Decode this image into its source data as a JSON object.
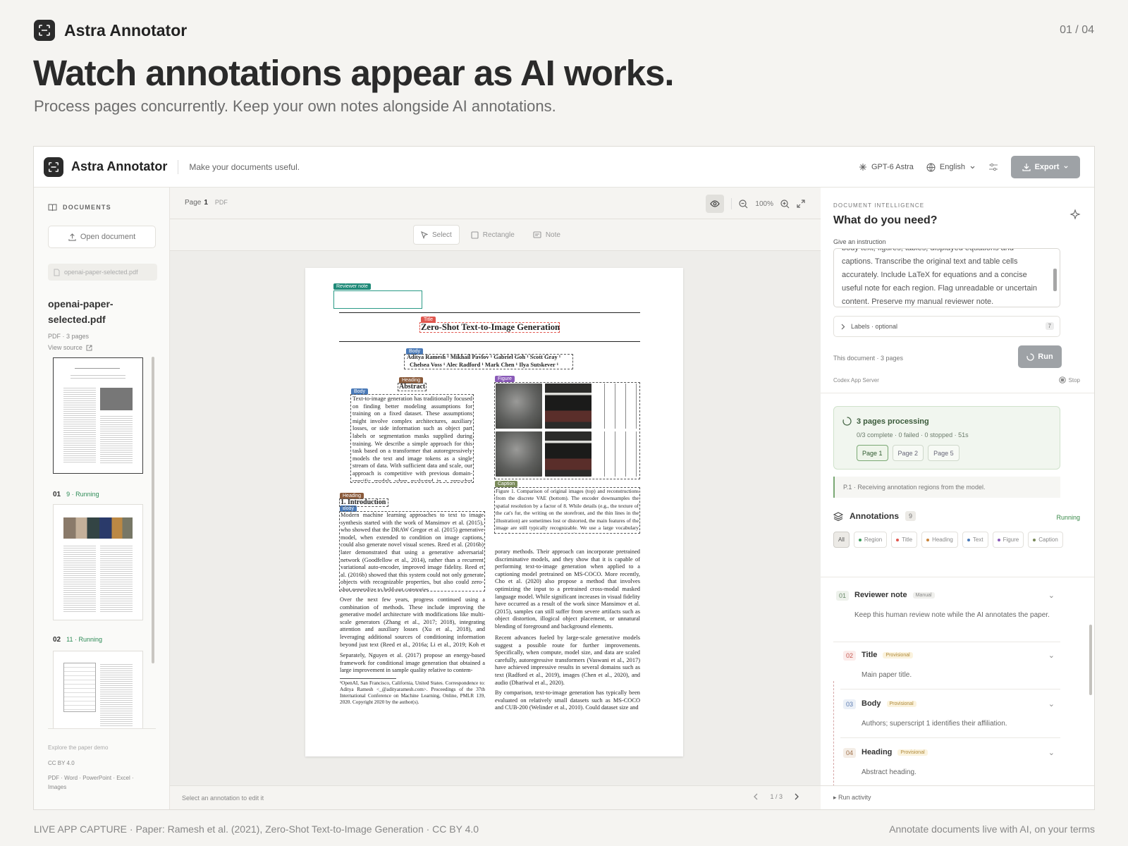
{
  "slide": {
    "brand": "Astra Annotator",
    "pager": "01 / 04",
    "headline": "Watch annotations appear as AI works.",
    "subheadline": "Process pages concurrently. Keep your own notes alongside AI annotations.",
    "footer_left": "LIVE APP CAPTURE · Paper: Ramesh et al. (2021), Zero-Shot Text-to-Image Generation · CC BY 4.0",
    "footer_right": "Annotate documents live with AI, on your terms"
  },
  "app": {
    "name": "Astra Annotator",
    "tagline": "Make your documents useful.",
    "model": "GPT-6 Astra",
    "language": "English",
    "export_label": "Export"
  },
  "sidebar": {
    "title": "DOCUMENTS",
    "open_label": "Open document",
    "file_chip": "openai-paper-selected.pdf",
    "doc_name": "openai-paper-selected.pdf",
    "doc_meta": "PDF · 3 pages",
    "view_source": "View source",
    "thumbs": [
      {
        "num": "01",
        "count": "9",
        "status": "· Running"
      },
      {
        "num": "02",
        "count": "11",
        "status": "· Running"
      }
    ],
    "foot_explore": "Explore the paper demo",
    "foot_license": "CC BY 4.0",
    "foot_formats": "PDF · Word · PowerPoint · Excel · Images"
  },
  "viewer": {
    "page_prefix": "Page",
    "page_num": "1",
    "page_type": "PDF",
    "zoom": "100%",
    "tools": {
      "select": "Select",
      "rectangle": "Rectangle",
      "note": "Note"
    },
    "footer_hint": "Select an annotation to edit it",
    "page_count": "1 / 3"
  },
  "paper": {
    "tags": {
      "reviewer": "Reviewer note",
      "title": "Title",
      "body": "Body",
      "heading": "Heading",
      "figure": "Figure",
      "caption": "Caption"
    },
    "title": "Zero-Shot Text-to-Image Generation",
    "authors_1": "Aditya Ramesh ¹  Mikhail Pavlov ¹  Gabriel Goh ¹  Scott Gray ¹",
    "authors_2": "Chelsea Voss ¹  Alec Radford ¹  Mark Chen ¹  Ilya Sutskever ¹",
    "abstract_heading": "Abstract",
    "abstract": "Text-to-image generation has traditionally focused on finding better modeling assumptions for training on a fixed dataset. These assumptions might involve complex architectures, auxiliary losses, or side information such as object part labels or segmentation masks supplied during training. We describe a simple approach for this task based on a transformer that autoregressively models the text and image tokens as a single stream of data. With sufficient data and scale, our approach is competitive with previous domain-specific models when evaluated in a zero-shot fashion.",
    "intro_heading": "1. Introduction",
    "intro": "Modern machine learning approaches to text to image synthesis started with the work of Mansimov et al. (2015), who showed that the DRAW Gregor et al. (2015) generative model, when extended to condition on image captions, could also generate novel visual scenes. Reed et al. (2016b) later demonstrated that using a generative adversarial network (Goodfellow et al., 2014), rather than a recurrent variational auto-encoder, improved image fidelity. Reed et al. (2016b) showed that this system could not only generate objects with recognizable properties, but also could zero-shot generalize to held-out categories.",
    "para2": "Over the next few years, progress continued using a combination of methods. These include improving the generative model architecture with modifications like multi-scale generators (Zhang et al., 2017; 2018), integrating attention and auxiliary losses (Xu et al., 2018), and leveraging additional sources of conditioning information beyond just text (Reed et al., 2016a; Li et al., 2019; Koh et al., 2021).",
    "para3": "Separately, Nguyen et al. (2017) propose an energy-based framework for conditional image generation that obtained a large improvement in sample quality relative to contem-",
    "footnote": "¹OpenAI, San Francisco, California, United States. Correspondence to: Aditya Ramesh <_@adityaramesh.com>. Proceedings of the 37th International Conference on Machine Learning, Online, PMLR 139, 2020. Copyright 2020 by the author(s).",
    "caption": "Figure 1. Comparison of original images (top) and reconstructions from the discrete VAE (bottom). The encoder downsamples the spatial resolution by a factor of 8. While details (e.g., the texture of the cat's fur, the writing on the storefront, and the thin lines in the illustration) are sometimes lost or distorted, the main features of the image are still typically recognizable. We use a large vocabulary size of 8192 to mitigate the loss of information.",
    "right1": "porary methods. Their approach can incorporate pretrained discriminative models, and they show that it is capable of performing text-to-image generation when applied to a captioning model pretrained on MS-COCO. More recently, Cho et al. (2020) also propose a method that involves optimizing the input to a pretrained cross-modal masked language model. While significant increases in visual fidelity have occurred as a result of the work since Mansimov et al. (2015), samples can still suffer from severe artifacts such as object distortion, illogical object placement, or unnatural blending of foreground and background elements.",
    "right2": "Recent advances fueled by large-scale generative models suggest a possible route for further improvements. Specifically, when compute, model size, and data are scaled carefully, autoregressive transformers (Vaswani et al., 2017) have achieved impressive results in several domains such as text (Radford et al., 2019), images (Chen et al., 2020), and audio (Dhariwal et al., 2020).",
    "right3": "By comparison, text-to-image generation has typically been evaluated on relatively small datasets such as MS-COCO and CUB-200 (Welinder et al., 2010). Could dataset size and"
  },
  "panel": {
    "kicker": "DOCUMENT INTELLIGENCE",
    "title": "What do you need?",
    "instruction_label": "Give an instruction",
    "instruction_text": "body text, figures, tables, displayed equations and captions. Transcribe the original text and table cells accurately. Include LaTeX for equations and a concise useful note for each region. Flag unreadable or uncertain content. Preserve my manual reviewer note.",
    "labels": "Labels · optional",
    "labels_count": "7",
    "doc_info": "This document · 3 pages",
    "run_label": "Run",
    "server": "Codex App Server",
    "stop_label": "Stop",
    "processing_title": "3 pages processing",
    "processing_stats": "0/3 complete · 0 failed · 0 stopped · 51s",
    "processing_pages": [
      "Page 1",
      "Page 2",
      "Page 5"
    ],
    "log": "P.1 · Receiving annotation regions from the model.",
    "annotations_title": "Annotations",
    "annotations_count": "9",
    "annotations_status": "Running",
    "filters": [
      {
        "label": "All",
        "color": ""
      },
      {
        "label": "Region",
        "color": "#3a9a5a"
      },
      {
        "label": "Title",
        "color": "#e0564e"
      },
      {
        "label": "Heading",
        "color": "#c9843a"
      },
      {
        "label": "Text",
        "color": "#4a7ab8"
      },
      {
        "label": "Figure",
        "color": "#8a5ab8"
      },
      {
        "label": "Caption",
        "color": "#7a8a5a"
      }
    ],
    "annotations": [
      {
        "num": "01",
        "title": "Reviewer note",
        "badge": "Manual",
        "desc": "Keep this human review note while the AI annotates the paper."
      },
      {
        "num": "02",
        "title": "Title",
        "badge": "Provisional",
        "desc": "Main paper title."
      },
      {
        "num": "03",
        "title": "Body",
        "badge": "Provisional",
        "desc": "Authors; superscript 1 identifies their affiliation."
      },
      {
        "num": "04",
        "title": "Heading",
        "badge": "Provisional",
        "desc": "Abstract heading."
      }
    ],
    "run_activity": "Run activity"
  }
}
